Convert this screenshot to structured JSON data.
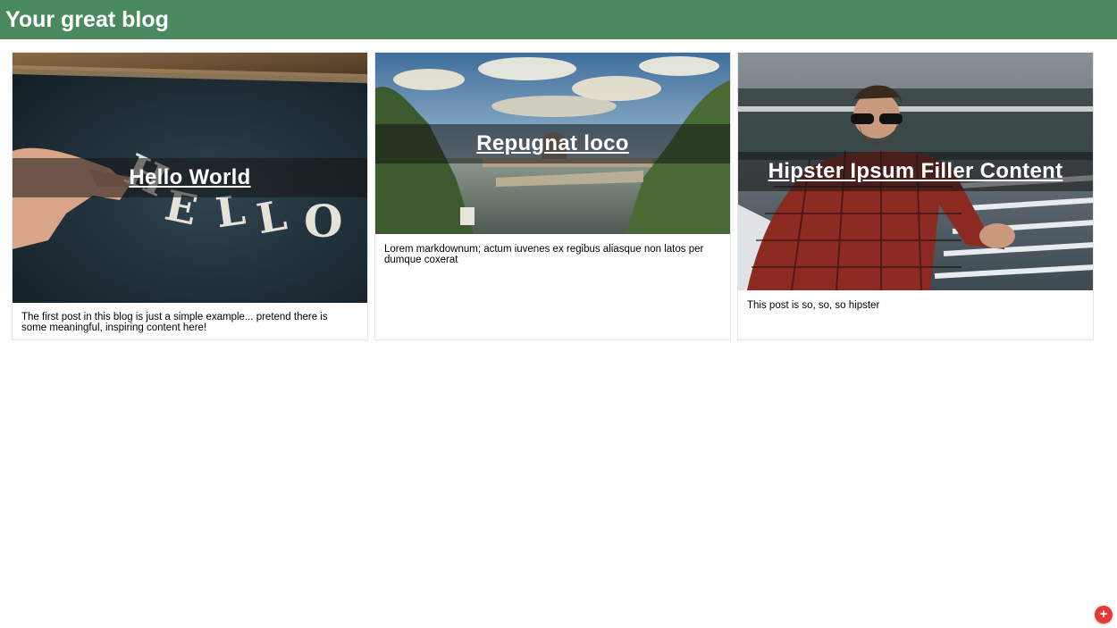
{
  "header": {
    "title": "Your great blog"
  },
  "posts": [
    {
      "title": "Hello World",
      "excerpt": "The first post in this blog is just a simple example... pretend there is some meaningful, inspiring content here!",
      "image_letters": [
        "H",
        "E",
        "L",
        "L",
        "O"
      ]
    },
    {
      "title": "Repugnat loco",
      "excerpt": "Lorem markdownum; actum iuvenes ex regibus aliasque non latos per dumque coxerat"
    },
    {
      "title": "Hipster Ipsum Filler Content",
      "excerpt": "This post is so, so, so hipster"
    }
  ],
  "fab": {
    "label": "+"
  },
  "colors": {
    "header": "#4b8a5f",
    "fab": "#e53935",
    "title_band": "rgba(20,20,20,0.55)"
  }
}
